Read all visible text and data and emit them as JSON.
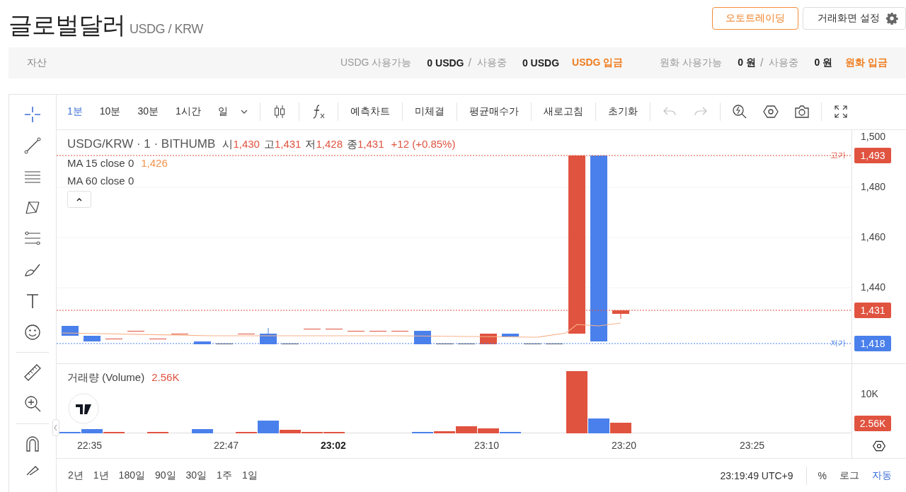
{
  "header": {
    "title": "글로벌달러",
    "pair": "USDG / KRW",
    "buttons": [
      {
        "kind": "accent",
        "label": "오토트레이딩"
      },
      {
        "kind": "settings",
        "label": "거래화면 설정"
      }
    ]
  },
  "assets": {
    "label": "자산",
    "groups": [
      {
        "label": "USDG 사용가능",
        "available": "0 USDG",
        "separator": "/",
        "in_use_label": "사용중",
        "in_use": "0 USDG",
        "deposit": "USDG 입금"
      },
      {
        "label": "원화 사용가능",
        "available": "0 원",
        "separator": "/",
        "in_use_label": "사용중",
        "in_use": "0 원",
        "deposit": "원화 입금"
      }
    ]
  },
  "toolbar": {
    "intervals": [
      {
        "label": "1분",
        "selected": true
      },
      {
        "label": "10분",
        "selected": false
      },
      {
        "label": "30분",
        "selected": false
      },
      {
        "label": "1시간",
        "selected": false
      },
      {
        "label": "일",
        "selected": false
      }
    ],
    "actions": [
      "예측차트",
      "미체결",
      "평균매수가",
      "새로고침",
      "초기화"
    ],
    "history": [
      {
        "kind": "undo",
        "disabled": true
      },
      {
        "kind": "redo",
        "disabled": true
      }
    ]
  },
  "legend": {
    "symbol": "USDG/KRW · 1 · BITHUMB",
    "ohlc": [
      {
        "label": "시",
        "value": "1,430"
      },
      {
        "label": "고",
        "value": "1,431"
      },
      {
        "label": "저",
        "value": "1,428"
      },
      {
        "label": "종",
        "value": "1,431"
      }
    ],
    "change": "+12 (+0.85%)",
    "indicators": [
      {
        "name": "MA 15 close 0",
        "value": "1,426"
      },
      {
        "name": "MA 60 close 0"
      }
    ]
  },
  "price_axis": {
    "ticks": [
      "1,500",
      "1,480",
      "1,460",
      "1,440"
    ],
    "tags": [
      {
        "label": "고가",
        "value": "1,493",
        "color": "#e0533f"
      },
      {
        "value": "1,431",
        "color": "#e0533f"
      },
      {
        "label": "저가",
        "value": "1,418",
        "color": "#4a80eb"
      }
    ]
  },
  "volume": {
    "label": "거래량 (Volume)",
    "value": "2.56K",
    "tick": "10K",
    "tag": "2.56K"
  },
  "time_axis": [
    {
      "label": "22:35",
      "bold": false
    },
    {
      "label": "22:47",
      "bold": false
    },
    {
      "label": "23:02",
      "bold": true
    },
    {
      "label": "23:10",
      "bold": false
    },
    {
      "label": "23:20",
      "bold": false
    },
    {
      "label": "23:25",
      "bold": false
    }
  ],
  "ranges": [
    "2년",
    "1년",
    "180일",
    "90일",
    "30일",
    "1주",
    "1일"
  ],
  "footer": {
    "time": "23:19:49 UTC+9",
    "scales": [
      {
        "label": "%",
        "selected": false
      },
      {
        "label": "로그",
        "selected": false
      },
      {
        "label": "자동",
        "selected": true
      }
    ]
  }
}
